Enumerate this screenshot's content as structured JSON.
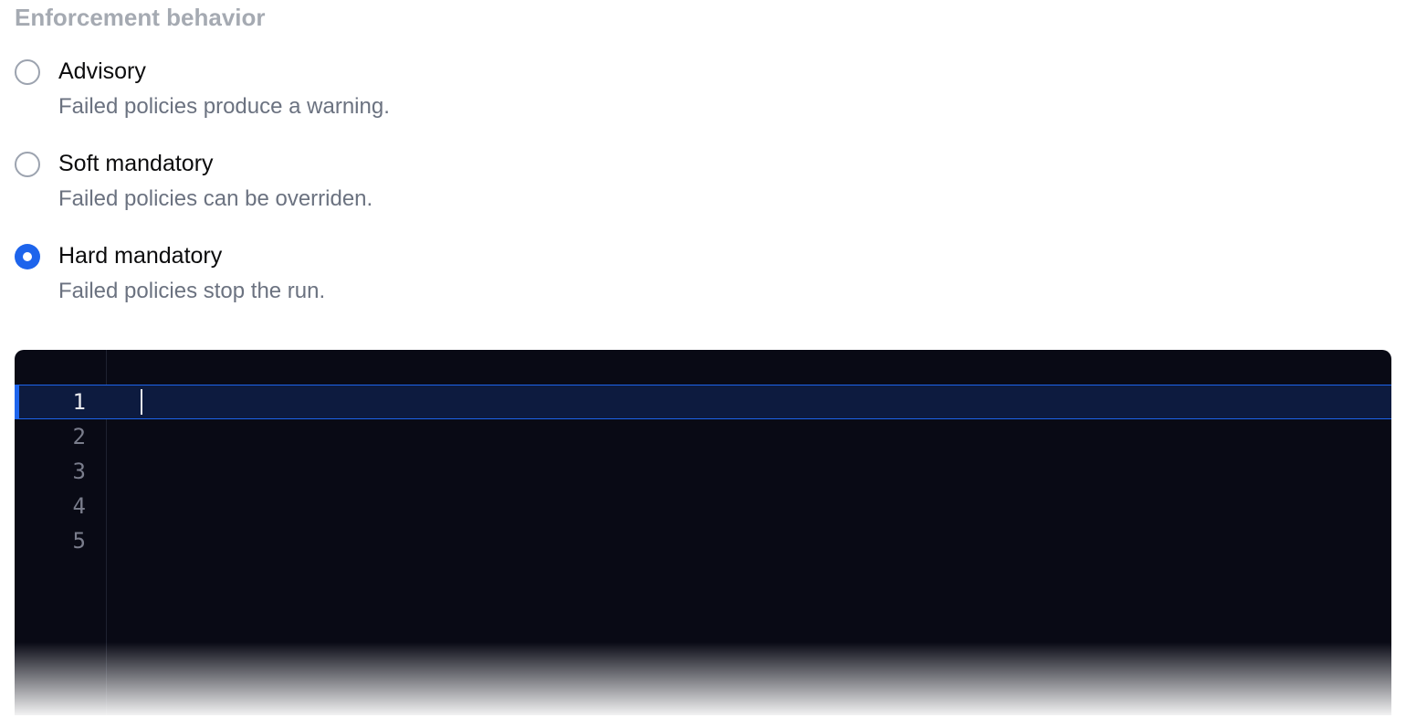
{
  "section": {
    "title": "Enforcement behavior"
  },
  "options": [
    {
      "label": "Advisory",
      "description": "Failed policies produce a warning.",
      "selected": false
    },
    {
      "label": "Soft mandatory",
      "description": "Failed policies can be overriden.",
      "selected": false
    },
    {
      "label": "Hard mandatory",
      "description": "Failed policies stop the run.",
      "selected": true
    }
  ],
  "editor": {
    "active_line": 1,
    "lines": [
      "1",
      "2",
      "3",
      "4",
      "5"
    ],
    "content": [
      "",
      "",
      "",
      "",
      ""
    ]
  }
}
